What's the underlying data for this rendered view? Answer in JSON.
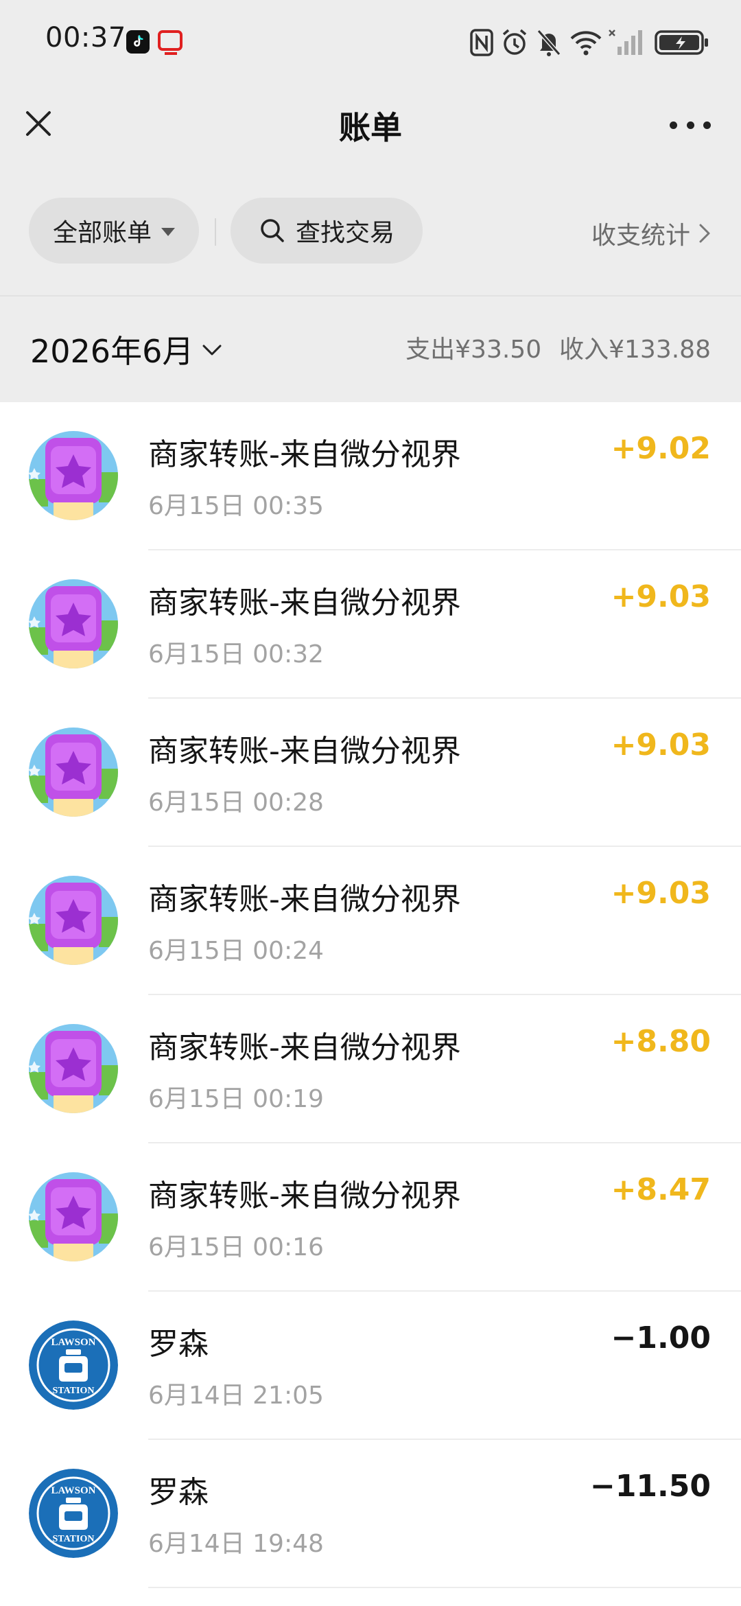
{
  "status_bar": {
    "time": "00:37",
    "icons": [
      "tiktok-icon",
      "redbook-icon",
      "nfc-icon",
      "alarm-icon",
      "mute-icon",
      "wifi-icon",
      "signal-icon",
      "battery-charging-icon"
    ]
  },
  "nav": {
    "title": "账单",
    "close_icon": "close-icon",
    "more_icon": "more-icon"
  },
  "filters": {
    "all_bills": "全部账单",
    "search": "查找交易",
    "stats": "收支统计"
  },
  "month": {
    "label": "2026年6月",
    "expense_label": "支出",
    "expense_value": "¥33.50",
    "income_label": "收入",
    "income_value": "¥133.88"
  },
  "transactions": [
    {
      "title": "商家转账-来自微分视界",
      "time": "6月15日 00:35",
      "amount": "+9.02",
      "kind": "income",
      "avatar": "game-star-avatar"
    },
    {
      "title": "商家转账-来自微分视界",
      "time": "6月15日 00:32",
      "amount": "+9.03",
      "kind": "income",
      "avatar": "game-star-avatar"
    },
    {
      "title": "商家转账-来自微分视界",
      "time": "6月15日 00:28",
      "amount": "+9.03",
      "kind": "income",
      "avatar": "game-star-avatar"
    },
    {
      "title": "商家转账-来自微分视界",
      "time": "6月15日 00:24",
      "amount": "+9.03",
      "kind": "income",
      "avatar": "game-star-avatar"
    },
    {
      "title": "商家转账-来自微分视界",
      "time": "6月15日 00:19",
      "amount": "+8.80",
      "kind": "income",
      "avatar": "game-star-avatar"
    },
    {
      "title": "商家转账-来自微分视界",
      "time": "6月15日 00:16",
      "amount": "+8.47",
      "kind": "income",
      "avatar": "game-star-avatar"
    },
    {
      "title": "罗森",
      "time": "6月14日 21:05",
      "amount": "−1.00",
      "kind": "expense",
      "avatar": "lawson-station-logo",
      "logo_text_top": "LAWSON",
      "logo_text_bottom": "STATION"
    },
    {
      "title": "罗森",
      "time": "6月14日 19:48",
      "amount": "−11.50",
      "kind": "expense",
      "avatar": "lawson-station-logo",
      "logo_text_top": "LAWSON",
      "logo_text_bottom": "STATION"
    }
  ],
  "colors": {
    "income": "#f0b71c",
    "expense": "#151515",
    "header_bg": "#ededed",
    "lawson_blue": "#1b6fb8"
  }
}
